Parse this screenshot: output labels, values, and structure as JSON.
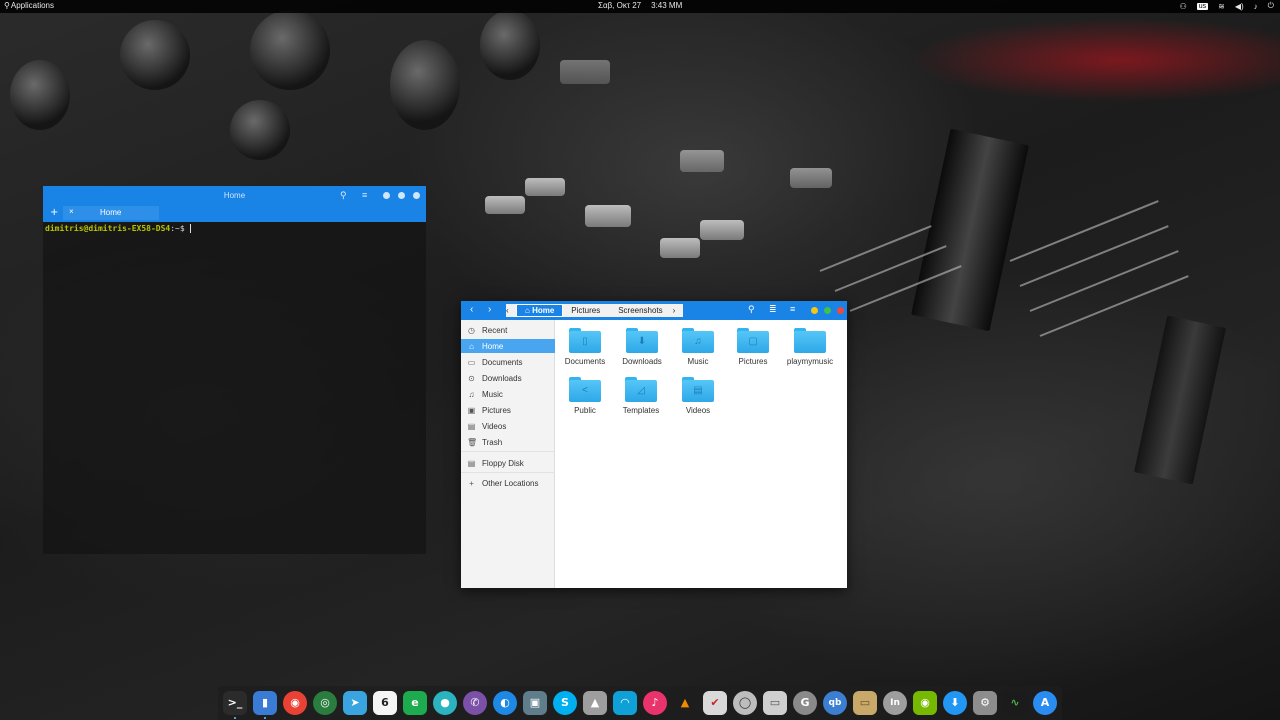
{
  "top_panel": {
    "applications": "Applications",
    "date": "Σαβ, Οκτ 27",
    "time": "3:43 ΜΜ",
    "keyboard_layout": "us",
    "tray_icons": [
      "network-icon",
      "keyboard-layout",
      "wifi-icon",
      "volume-icon",
      "notifications-icon",
      "system-menu-icon"
    ]
  },
  "terminal": {
    "title": "Home",
    "tab_label": "Home",
    "new_tab": "+",
    "close_tab": "×",
    "prompt_user": "dimitris@dimitris-EX58-DS4",
    "prompt_path": ":~$",
    "accent": "#1a83e6"
  },
  "files": {
    "breadcrumbs": [
      "Home",
      "Pictures",
      "Screenshots"
    ],
    "sidebar": [
      {
        "label": "Recent",
        "icon": "◷"
      },
      {
        "label": "Home",
        "icon": "⌂"
      },
      {
        "label": "Documents",
        "icon": "▭"
      },
      {
        "label": "Downloads",
        "icon": "⊙"
      },
      {
        "label": "Music",
        "icon": "♫"
      },
      {
        "label": "Pictures",
        "icon": "▣"
      },
      {
        "label": "Videos",
        "icon": "▤"
      },
      {
        "label": "Trash",
        "icon": "🗑"
      },
      {
        "label": "Floppy Disk",
        "icon": "▤"
      },
      {
        "label": "Other Locations",
        "icon": "+"
      }
    ],
    "folders": [
      {
        "label": "Documents",
        "glyph": "▯"
      },
      {
        "label": "Downloads",
        "glyph": "⬇"
      },
      {
        "label": "Music",
        "glyph": "♫"
      },
      {
        "label": "Pictures",
        "glyph": "▢"
      },
      {
        "label": "playmymusic",
        "glyph": ""
      },
      {
        "label": "Public",
        "glyph": "<"
      },
      {
        "label": "Templates",
        "glyph": "◿"
      },
      {
        "label": "Videos",
        "glyph": "▤"
      }
    ],
    "accent": "#1a83e6"
  },
  "dock": {
    "apps": [
      {
        "name": "terminal",
        "glyph": ">_",
        "color": "#2b2b2b"
      },
      {
        "name": "files",
        "glyph": "▮",
        "color": "#3a7bd5"
      },
      {
        "name": "chrome",
        "glyph": "◉",
        "color": "#e94235"
      },
      {
        "name": "network",
        "glyph": "◎",
        "color": "#2a7c3f"
      },
      {
        "name": "telegram",
        "glyph": "➤",
        "color": "#3aa4e0"
      },
      {
        "name": "calendar",
        "glyph": "6",
        "color": "#f5f5f5"
      },
      {
        "name": "editor",
        "glyph": "e",
        "color": "#1eaa4e"
      },
      {
        "name": "globe",
        "glyph": "●",
        "color": "#2bb3c0"
      },
      {
        "name": "viber",
        "glyph": "✆",
        "color": "#7b51a8"
      },
      {
        "name": "browser",
        "glyph": "◐",
        "color": "#1e88e5"
      },
      {
        "name": "screenshot",
        "glyph": "▣",
        "color": "#607d8b"
      },
      {
        "name": "skype",
        "glyph": "S",
        "color": "#00aff0"
      },
      {
        "name": "drive",
        "glyph": "▲",
        "color": "#9e9e9e"
      },
      {
        "name": "headphones",
        "glyph": "◠",
        "color": "#0fa0d8"
      },
      {
        "name": "music",
        "glyph": "♪",
        "color": "#e8336d"
      },
      {
        "name": "vlc",
        "glyph": "▲",
        "color": "#f08a00"
      },
      {
        "name": "tasks",
        "glyph": "✔",
        "color": "#d9d9d9"
      },
      {
        "name": "audio",
        "glyph": "◯",
        "color": "#bdbdbd"
      },
      {
        "name": "notes",
        "glyph": "▭",
        "color": "#cfcfcf"
      },
      {
        "name": "gimp",
        "glyph": "G",
        "color": "#8a8a8a"
      },
      {
        "name": "qbittorrent",
        "glyph": "qb",
        "color": "#3c7fd1"
      },
      {
        "name": "archive",
        "glyph": "▭",
        "color": "#c8a96a"
      },
      {
        "name": "inkscape",
        "glyph": "In",
        "color": "#9e9e9e"
      },
      {
        "name": "nvidia",
        "glyph": "◉",
        "color": "#76b900"
      },
      {
        "name": "download",
        "glyph": "⬇",
        "color": "#2196f3"
      },
      {
        "name": "settings",
        "glyph": "⚙",
        "color": "#8d8d8d"
      },
      {
        "name": "monitor",
        "glyph": "∿",
        "color": "#1b1b1b"
      },
      {
        "name": "appstore",
        "glyph": "A",
        "color": "#2a8cf0"
      }
    ]
  }
}
